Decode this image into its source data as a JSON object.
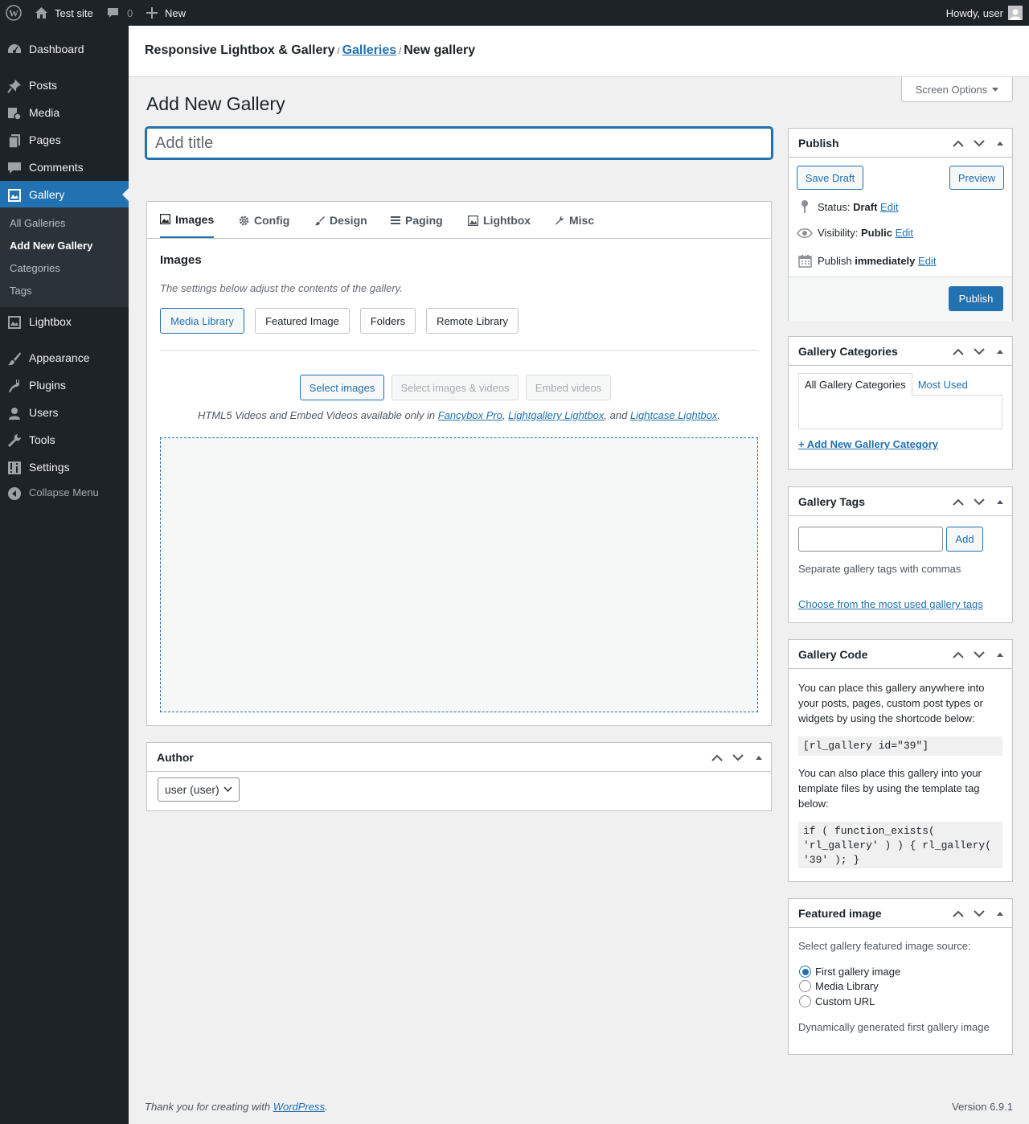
{
  "adminbar": {
    "site_name": "Test site",
    "comments_count": "0",
    "new_label": "New",
    "howdy": "Howdy, user"
  },
  "sidebar": {
    "items": [
      {
        "label": "Dashboard",
        "icon": "dashboard-icon"
      },
      {
        "label": "Posts",
        "icon": "pin-icon"
      },
      {
        "label": "Media",
        "icon": "media-icon"
      },
      {
        "label": "Pages",
        "icon": "pages-icon"
      },
      {
        "label": "Comments",
        "icon": "comment-icon"
      },
      {
        "label": "Gallery",
        "icon": "gallery-icon",
        "current": true
      },
      {
        "label": "Lightbox",
        "icon": "lightbox-icon"
      },
      {
        "label": "Appearance",
        "icon": "brush-icon"
      },
      {
        "label": "Plugins",
        "icon": "plugin-icon"
      },
      {
        "label": "Users",
        "icon": "users-icon"
      },
      {
        "label": "Tools",
        "icon": "wrench-icon"
      },
      {
        "label": "Settings",
        "icon": "settings-icon"
      },
      {
        "label": "Collapse Menu",
        "icon": "collapse-icon"
      }
    ],
    "submenu": [
      "All Galleries",
      "Add New Gallery",
      "Categories",
      "Tags"
    ]
  },
  "header": {
    "plugin_name": "Responsive Lightbox & Gallery",
    "sep": "/",
    "galleries_link": "Galleries",
    "current": "New gallery",
    "screen_options": "Screen Options"
  },
  "page": {
    "title": "Add New Gallery",
    "title_placeholder": "Add title"
  },
  "gallery": {
    "tabs": [
      "Images",
      "Config",
      "Design",
      "Paging",
      "Lightbox",
      "Misc"
    ],
    "active_tab": "Images",
    "heading": "Images",
    "description": "The settings below adjust the contents of the gallery.",
    "sources": [
      "Media Library",
      "Featured Image",
      "Folders",
      "Remote Library"
    ],
    "actions": [
      "Select images",
      "Select images & videos",
      "Embed videos"
    ],
    "note_prefix": "HTML5 Videos and Embed Videos available only in ",
    "note_links": [
      "Fancybox Pro",
      "Lightgallery Lightbox",
      "Lightcase Lightbox"
    ],
    "note_sep1": ", ",
    "note_sep2": ", and ",
    "note_end": "."
  },
  "author": {
    "title": "Author",
    "selected": "user (user)"
  },
  "publish": {
    "title": "Publish",
    "save_draft": "Save Draft",
    "preview": "Preview",
    "status_label": "Status: ",
    "status_value": "Draft",
    "visibility_label": "Visibility: ",
    "visibility_value": "Public",
    "publish_label": "Publish ",
    "publish_value": "immediately",
    "edit": "Edit",
    "publish_button": "Publish"
  },
  "categories": {
    "title": "Gallery Categories",
    "tab_all": "All Gallery Categories",
    "tab_most_used": "Most Used",
    "add_new": "+ Add New Gallery Category"
  },
  "tags": {
    "title": "Gallery Tags",
    "add_button": "Add",
    "help": "Separate gallery tags with commas",
    "choose_link": "Choose from the most used gallery tags"
  },
  "code": {
    "title": "Gallery Code",
    "intro": "You can place this gallery anywhere into your posts, pages, custom post types or widgets by using the shortcode below:",
    "shortcode": "[rl_gallery id=\"39\"]",
    "template_intro": "You can also place this gallery into your template files by using the template tag below:",
    "template_code_1": "if ( function_exists(",
    "template_code_2": "'rl_gallery' ) ) { rl_gallery(",
    "template_code_3": "'39' ); }"
  },
  "featured": {
    "title": "Featured image",
    "prompt": "Select gallery featured image source:",
    "options": [
      "First gallery image",
      "Media Library",
      "Custom URL"
    ],
    "selected_index": 0,
    "note": "Dynamically generated first gallery image"
  },
  "footer": {
    "thanks_prefix": "Thank you for creating with ",
    "wp_link": "WordPress",
    "thanks_suffix": ".",
    "version": "Version 6.9.1"
  },
  "colors": {
    "accent": "#2271b1",
    "adminbar_bg": "#1d2327",
    "background": "#f0f0f1"
  }
}
